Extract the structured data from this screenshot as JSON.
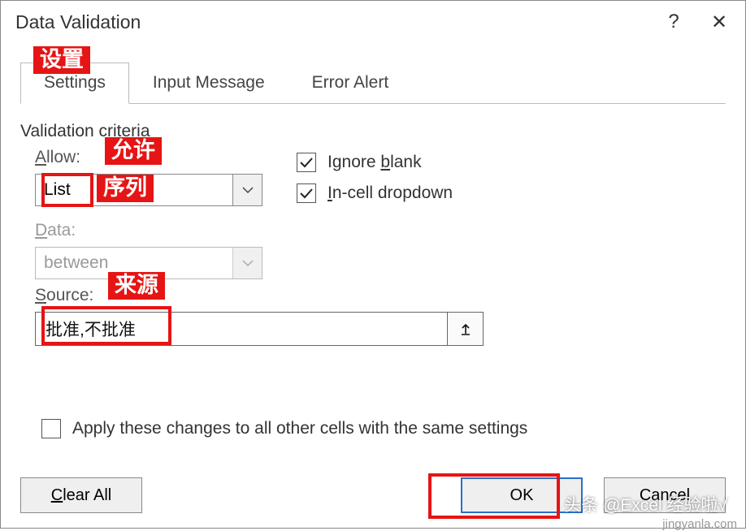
{
  "dialog": {
    "title": "Data Validation",
    "help": "?",
    "close": "✕"
  },
  "tabs": {
    "settings": "Settings",
    "input_message": "Input Message",
    "error_alert": "Error Alert"
  },
  "section": {
    "criteria": "Validation criteria"
  },
  "allow": {
    "label_pre": "A",
    "label_rest": "llow:",
    "value": "List"
  },
  "data": {
    "label_pre": "D",
    "label_rest": "ata:",
    "value": "between"
  },
  "source": {
    "label_pre": "S",
    "label_rest": "ource:",
    "value": "批准,不批准"
  },
  "checks": {
    "ignore_pre": "Ignore ",
    "ignore_u": "b",
    "ignore_post": "lank",
    "incell_pre": "I",
    "incell_rest": "n-cell dropdown",
    "apply_pre": "Apply these changes to all other cells with the same settings"
  },
  "buttons": {
    "clear_pre": "C",
    "clear_rest": "lear All",
    "ok": "OK",
    "cancel": "Cancel"
  },
  "annotations": {
    "settings_cn": "设置",
    "allow_cn": "允许",
    "list_cn": "序列",
    "source_cn": "来源"
  },
  "watermark": {
    "line1": "头条 @Excel 经验啦√",
    "line2": "jingyanla.com"
  }
}
